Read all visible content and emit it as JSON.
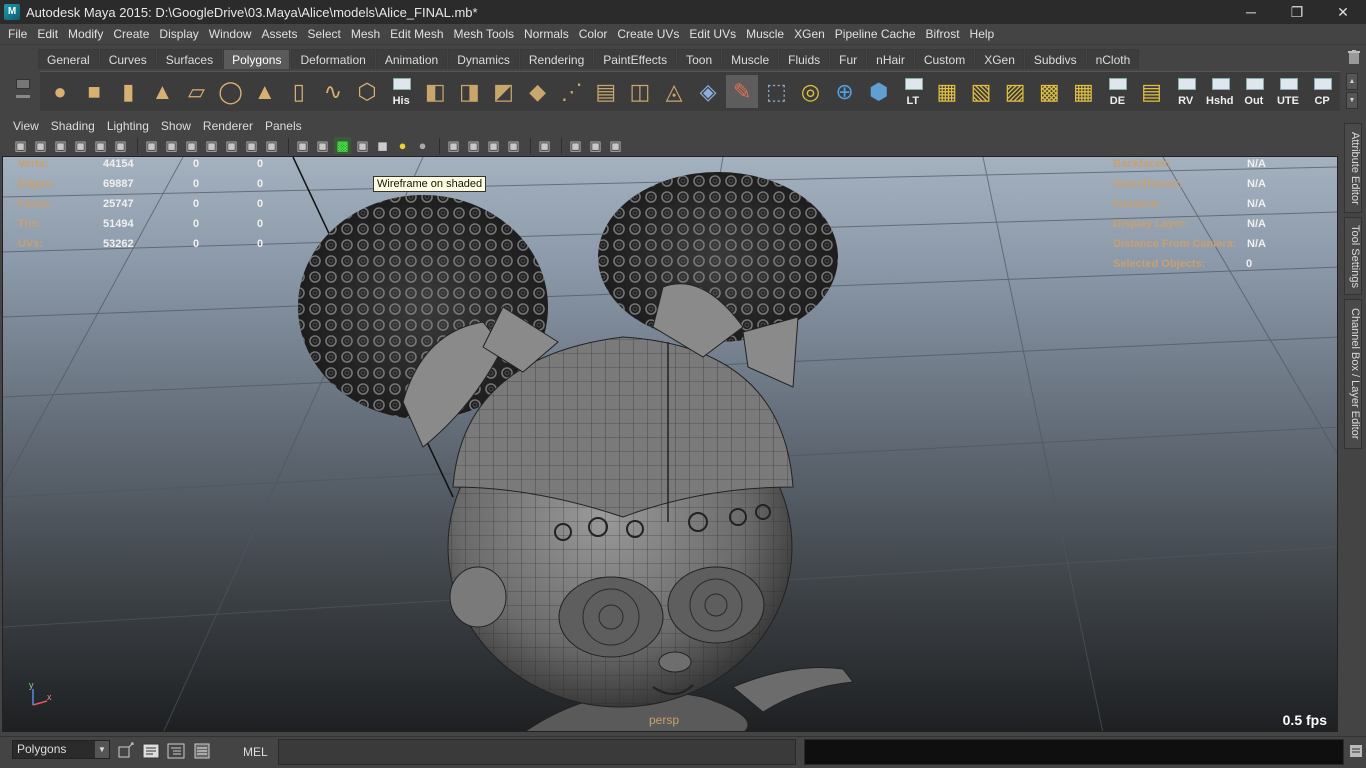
{
  "window": {
    "title": "Autodesk Maya 2015: D:\\GoogleDrive\\03.Maya\\Alice\\models\\Alice_FINAL.mb*",
    "icon_label": "M",
    "minimize": "─",
    "restore": "❐",
    "close": "✕"
  },
  "menubar": [
    "File",
    "Edit",
    "Modify",
    "Create",
    "Display",
    "Window",
    "Assets",
    "Select",
    "Mesh",
    "Edit Mesh",
    "Mesh Tools",
    "Normals",
    "Color",
    "Create UVs",
    "Edit UVs",
    "Muscle",
    "XGen",
    "Pipeline Cache",
    "Bifrost",
    "Help"
  ],
  "shelf": {
    "tabs": [
      "General",
      "Curves",
      "Surfaces",
      "Polygons",
      "Deformation",
      "Animation",
      "Dynamics",
      "Rendering",
      "PaintEffects",
      "Toon",
      "Muscle",
      "Fluids",
      "Fur",
      "nHair",
      "Custom",
      "XGen",
      "Subdivs",
      "nCloth"
    ],
    "active_tab": "Polygons",
    "icons": [
      {
        "name": "poly-sphere-icon"
      },
      {
        "name": "poly-cube-icon"
      },
      {
        "name": "poly-cylinder-icon"
      },
      {
        "name": "poly-cone-icon"
      },
      {
        "name": "poly-plane-icon"
      },
      {
        "name": "poly-torus-icon"
      },
      {
        "name": "poly-pyramid-icon"
      },
      {
        "name": "poly-pipe-icon"
      },
      {
        "name": "poly-helix-icon"
      },
      {
        "name": "poly-soccer-icon"
      },
      {
        "name": "history-icon",
        "label": "His"
      },
      {
        "name": "combine-icon"
      },
      {
        "name": "separate-icon"
      },
      {
        "name": "extract-icon"
      },
      {
        "name": "smooth-icon"
      },
      {
        "name": "split-polygon-icon"
      },
      {
        "name": "extrude-face-icon"
      },
      {
        "name": "bridge-icon"
      },
      {
        "name": "append-polygon-icon"
      },
      {
        "name": "sculpt-geometry-icon"
      },
      {
        "name": "paint-tool-icon"
      },
      {
        "name": "wireframe-cage-icon"
      },
      {
        "name": "quad-draw-icon"
      },
      {
        "name": "modeling-toolkit-icon"
      },
      {
        "name": "transfer-attributes-icon"
      },
      {
        "name": "lt-icon",
        "label": "LT"
      },
      {
        "name": "uv-planar-icon"
      },
      {
        "name": "uv-cylindrical-icon"
      },
      {
        "name": "uv-spherical-icon"
      },
      {
        "name": "uv-automatic-icon"
      },
      {
        "name": "uv-editor-icon"
      },
      {
        "name": "de-icon",
        "label": "DE"
      },
      {
        "name": "uv-layout-icon"
      },
      {
        "name": "rv-icon",
        "label": "RV"
      },
      {
        "name": "hshd-icon",
        "label": "Hshd"
      },
      {
        "name": "out-icon",
        "label": "Out"
      },
      {
        "name": "ute-icon",
        "label": "UTE"
      },
      {
        "name": "cp-icon",
        "label": "CP"
      }
    ]
  },
  "panel": {
    "menus": [
      "View",
      "Shading",
      "Lighting",
      "Show",
      "Renderer",
      "Panels"
    ],
    "tooltip": "Wireframe on shaded",
    "camera": "persp",
    "fps": "0.5 fps",
    "axis_y": "y",
    "axis_x": "x"
  },
  "hud_left": [
    {
      "label": "Verts:",
      "v1": "44154",
      "v2": "0",
      "v3": "0"
    },
    {
      "label": "Edges:",
      "v1": "69887",
      "v2": "0",
      "v3": "0"
    },
    {
      "label": "Faces:",
      "v1": "25747",
      "v2": "0",
      "v3": "0"
    },
    {
      "label": "Tris:",
      "v1": "51494",
      "v2": "0",
      "v3": "0"
    },
    {
      "label": "UVs:",
      "v1": "53262",
      "v2": "0",
      "v3": "0"
    }
  ],
  "hud_right": [
    {
      "label": "Backfaces:",
      "value": "N/A"
    },
    {
      "label": "Smoothness:",
      "value": "N/A"
    },
    {
      "label": "Instance:",
      "value": "N/A"
    },
    {
      "label": "Display Layer:",
      "value": "N/A"
    },
    {
      "label": "Distance From Camera:",
      "value": "N/A"
    },
    {
      "label": "Selected Objects:",
      "value": "0"
    }
  ],
  "side_tabs": [
    "Attribute Editor",
    "Tool Settings",
    "Channel Box / Layer Editor"
  ],
  "cmdline": {
    "mode": "Polygons",
    "mel_label": "MEL",
    "input_value": ""
  },
  "colors": {
    "hud_label": "#c8a070",
    "hud_value": "#f0f0f0",
    "viewport_top": "#a4b1bf",
    "viewport_bottom": "#1e2022"
  }
}
